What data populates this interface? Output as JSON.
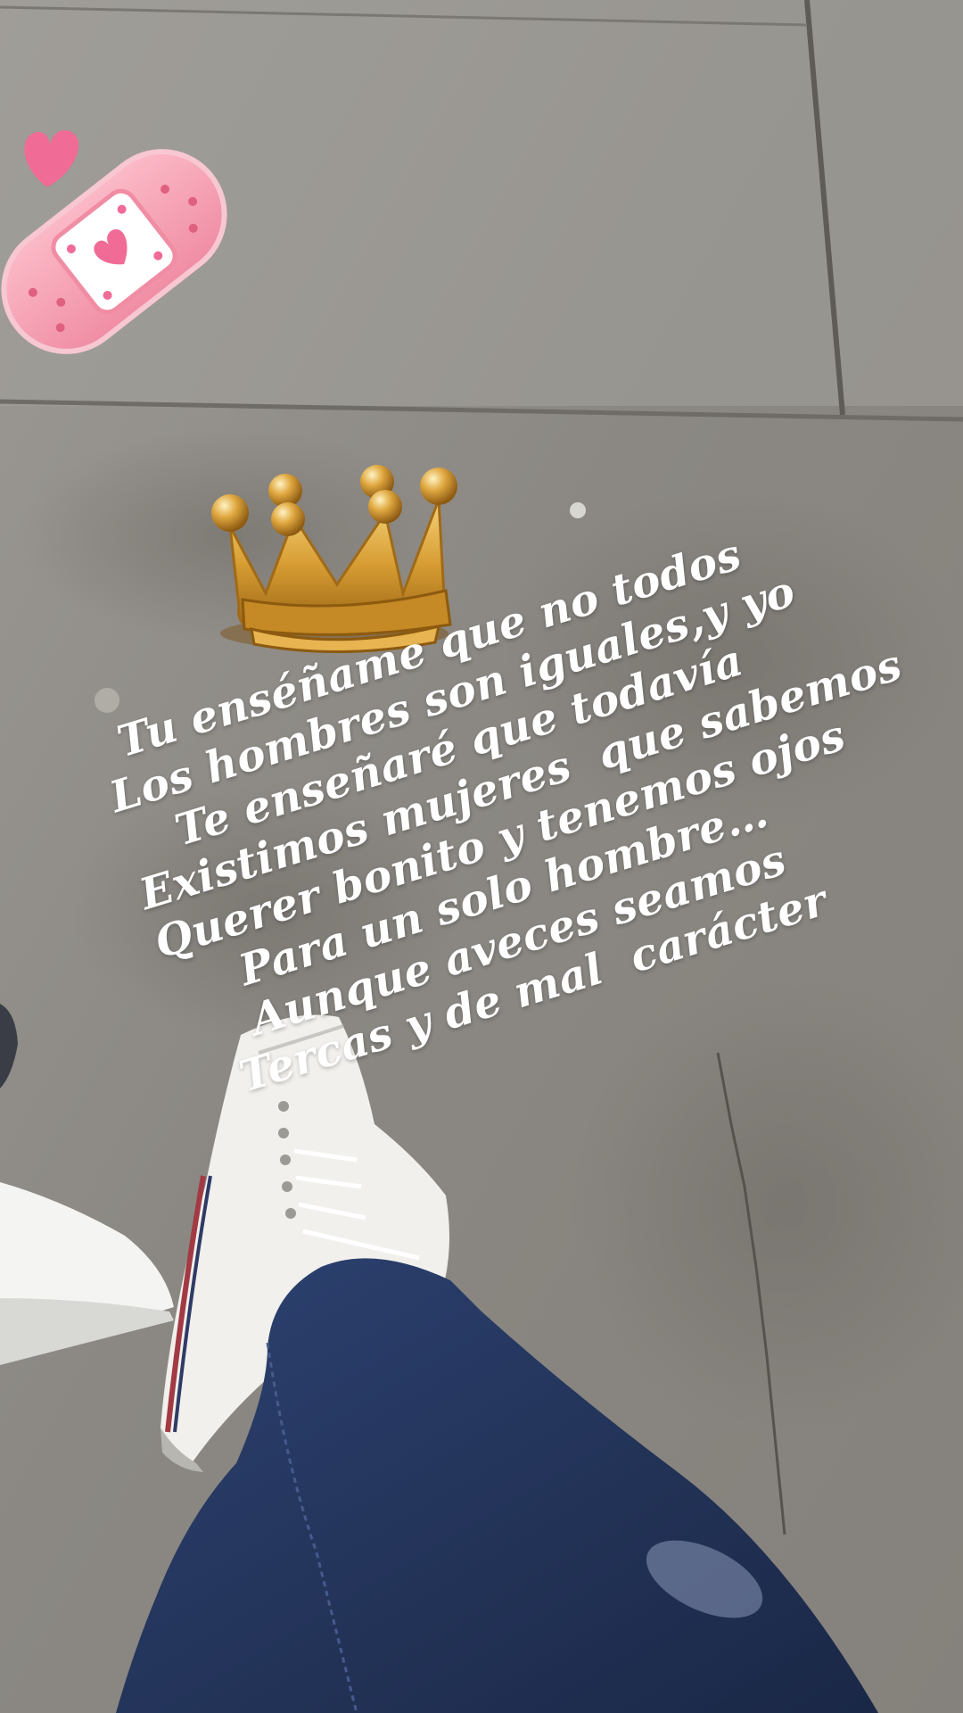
{
  "story": {
    "caption_lines": [
      "Tu enséñame que no todos",
      "Los hombres son iguales,y yo",
      "Te enseñaré que todavía",
      "Existimos mujeres  que sabemos",
      "Querer bonito y tenemos ojos",
      "Para un solo hombre…",
      "Aunque aveces seamos",
      "Tercas y de mal  carácter"
    ],
    "stickers": [
      "heart-icon",
      "bandage-icon",
      "crown-icon"
    ],
    "colors": {
      "pavement": "#8f8c87",
      "bandage": "#f6a2b3",
      "heart": "#f06b96",
      "crown": "#d8a13a",
      "jeans": "#24355e",
      "sneaker": "#f1f0ec"
    }
  }
}
